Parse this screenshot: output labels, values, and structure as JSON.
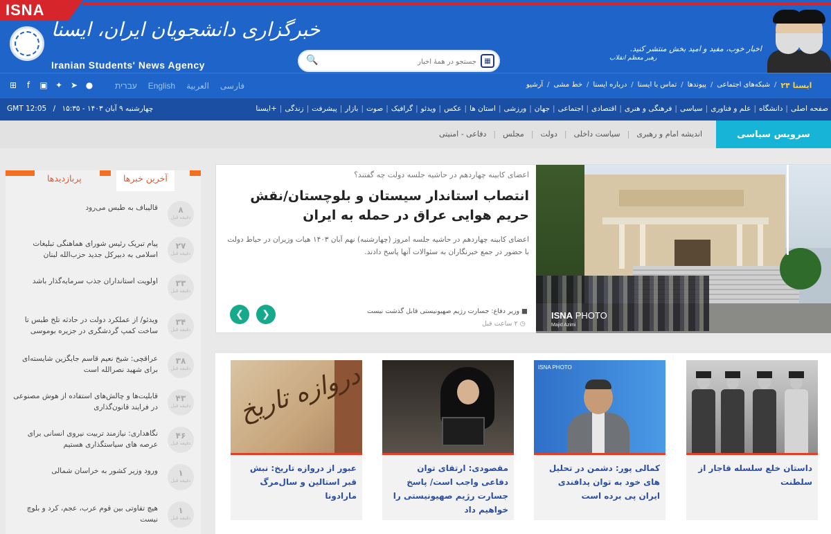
{
  "header": {
    "brand_tag": "ISNA",
    "logo_fa": "خبرگزاری دانشجویان ایران، ایسنا",
    "logo_en": "Iranian Students' News Agency",
    "search_placeholder": "جستجو در همهٔ اخبار",
    "slogan": "اخبار خوب، مفید و امید بخش منتشر کنید.",
    "slogan_attr": "رهبر معظم انقلاب"
  },
  "topbar": {
    "social_icons": [
      "windows-icon",
      "facebook-icon",
      "instagram-icon",
      "twitter-icon",
      "telegram-icon",
      "rss-icon"
    ],
    "languages": [
      "עברית",
      "English",
      "العربية",
      "فارسی"
    ],
    "links": [
      "آرشیو",
      "خط مشی",
      "درباره ایسنا",
      "تماس با ایسنا",
      "پیوندها",
      "شبکه‌های اجتماعی"
    ],
    "isna24": "ایسنا ۲۴"
  },
  "mainnav": {
    "items": [
      "صفحه اصلی",
      "دانشگاه",
      "علم و فناوری",
      "سیاسی",
      "فرهنگی و هنری",
      "اقتصادی",
      "اجتماعی",
      "جهان",
      "ورزشی",
      "استان ها",
      "عکس",
      "ویدئو",
      "گرافیک",
      "صوت",
      "بازار",
      "پیشرفت",
      "زندگی",
      "ایسنا+"
    ],
    "date": "چهارشنبه ۹ آبان ۱۴۰۳ - ۱۵:۳۵",
    "gmt": "GMT 12:05"
  },
  "service": {
    "title": "سرویس سیاسی",
    "links": [
      "اندیشه امام و رهبری",
      "سیاست داخلی",
      "دولت",
      "مجلس",
      "دفاعی - امنیتی"
    ]
  },
  "sidebar": {
    "tab_latest": "آخرین خبرها",
    "tab_popular": "پربازدیدها",
    "unit": "دقیقه قبل",
    "items": [
      {
        "n": "۸",
        "text": "قالیباف به طبس می‌رود"
      },
      {
        "n": "۲۷",
        "text": "پیام تبریک رئیس شورای هماهنگی تبلیغات اسلامی به دبیرکل جدید حزب‌الله لبنان"
      },
      {
        "n": "۳۳",
        "text": "اولویت استانداران جذب سرمایه‌گذار باشد"
      },
      {
        "n": "۳۴",
        "text": "ویدئو/ از عملکرد دولت در حادثه تلخ طبس تا ساخت کمپ گردشگری در جزیره بوموسی"
      },
      {
        "n": "۳۸",
        "text": "عراقچی: شیخ نعیم قاسم جایگزین شایسته‌ای برای شهید نصرالله است"
      },
      {
        "n": "۴۳",
        "text": "قابلیت‌ها و چالش‌های استفاده از هوش مصنوعی در فرایند قانون‌گذاری"
      },
      {
        "n": "۴۶",
        "text": "نگاهداری: نیازمند تربیت نیروی انسانی برای عرصه های سیاستگذاری هستیم"
      },
      {
        "n": "۱",
        "text": "ورود وزیر کشور به خراسان شمالی"
      },
      {
        "n": "۱",
        "text": "هیچ تفاوتی بین قوم عرب، عجم، کرد و بلوچ نیست"
      }
    ]
  },
  "featured": {
    "kicker": "اعضای کابینه چهاردهم در حاشیه جلسه دولت چه گفتند؟",
    "title": "انتصاب استاندار سیستان و بلوچستان/نقش حریم هوایی عراق در حمله به ایران",
    "lead": "اعضای کابینه چهاردهم در حاشیه جلسه امروز (چهارشنبه) نهم آبان ۱۴۰۳ هیات وزیران در حیاط دولت با حضور در جمع خبرنگاران به سئوالات آنها پاسخ دادند.",
    "related": "وزیر دفاع: جسارت رژیم صهیونیستی قابل گذشت نیست",
    "time": "۲ ساعت قبل",
    "photo_watermark": "ISNA",
    "photo_watermark2": "PHOTO",
    "photo_credit": "Majid Azimi"
  },
  "cards": [
    {
      "title": "عبور از دروازه تاریخ: نبش قبر استالین و سال‌مرگ مارادونا",
      "thumb_text": "دروازه تاریخ"
    },
    {
      "title": "مقصودی: ارتقای توان دفاعی واجب است/ پاسخ جسارت رژیم صهیونیستی را خواهیم داد"
    },
    {
      "title": "کمالی پور: دشمن در تحلیل های خود به توان پدافندی ایران پی برده است",
      "thumb_text": "ISNA PHOTO"
    },
    {
      "title": "داستان خلع سلسله قاجار از سلطنت"
    }
  ]
}
